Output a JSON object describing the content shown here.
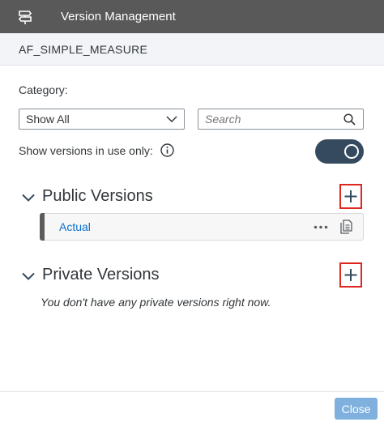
{
  "dialog": {
    "title": "Version Management",
    "icon": "versions-icon"
  },
  "subheader": {
    "model_name": "AF_SIMPLE_MEASURE"
  },
  "filters": {
    "category_label": "Category:",
    "category_value": "Show All",
    "search_placeholder": "Search",
    "search_value": ""
  },
  "in_use_toggle": {
    "label": "Show versions in use only:",
    "state": "on"
  },
  "public_versions": {
    "title": "Public Versions",
    "expanded": true,
    "items": [
      {
        "label": "Actual"
      }
    ]
  },
  "private_versions": {
    "title": "Private Versions",
    "expanded": true,
    "empty_message": "You don't have any private versions right now."
  },
  "footer": {
    "close_label": "Close"
  },
  "colors": {
    "titlebar": "#595959",
    "toggle_on": "#354a5f",
    "link": "#0a6ed1",
    "highlight": "#e0271f",
    "close_button": "#7fb0de"
  }
}
